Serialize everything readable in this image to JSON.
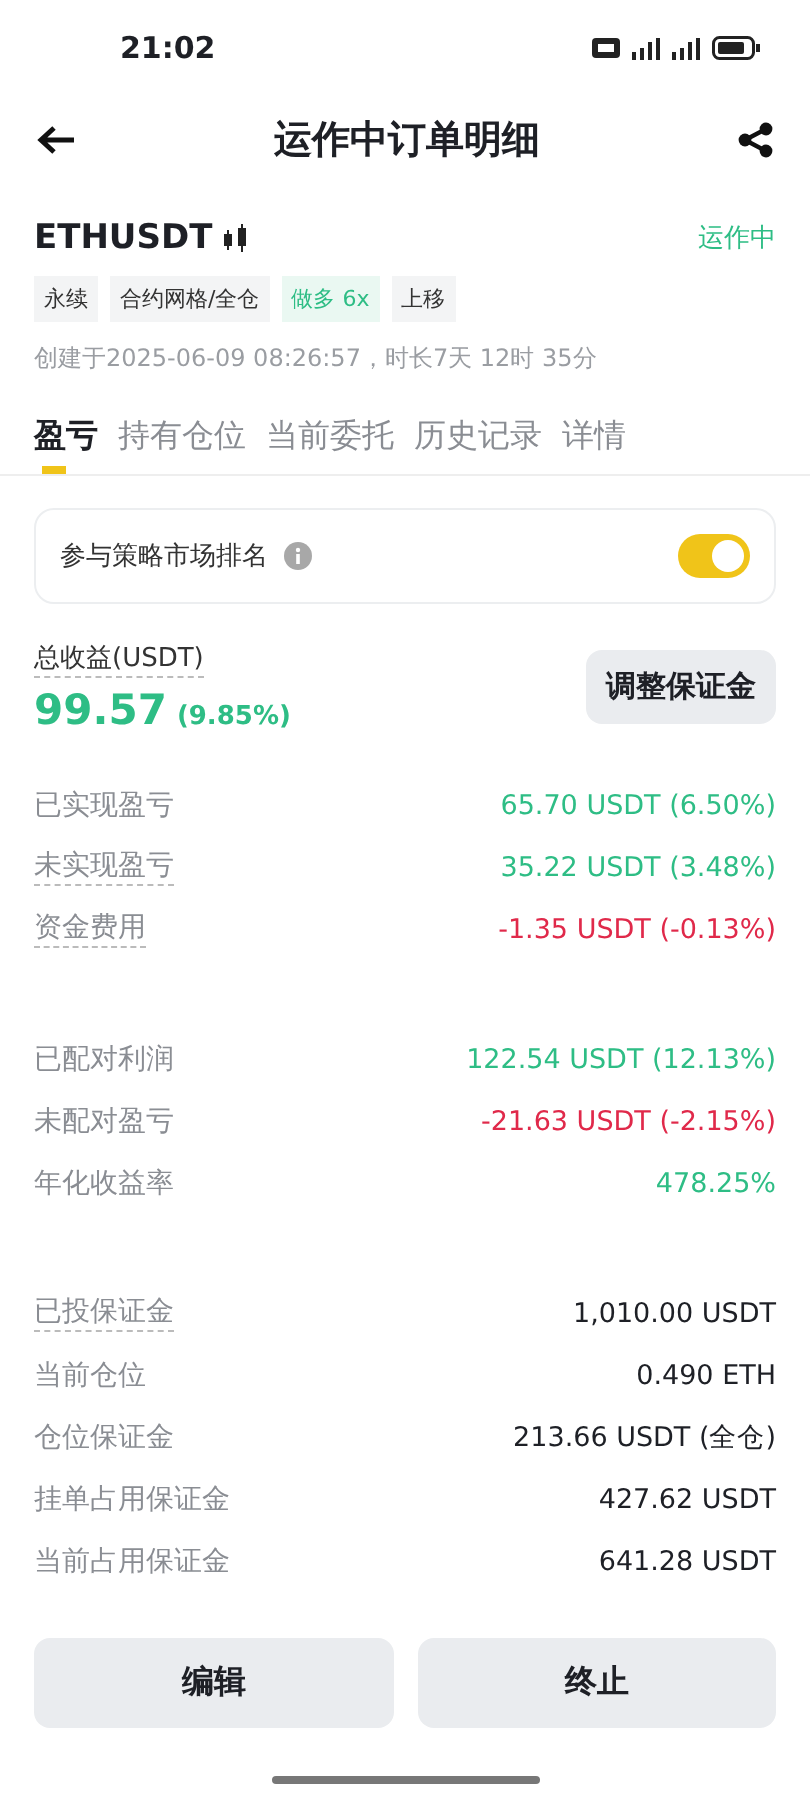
{
  "status_bar": {
    "time": "21:02"
  },
  "header": {
    "title": "运作中订单明细"
  },
  "order": {
    "symbol": "ETHUSDT",
    "status": "运作中",
    "tags": [
      {
        "label": "永续",
        "kind": "plain"
      },
      {
        "label": "合约网格/全仓",
        "kind": "plain"
      },
      {
        "label": "做多 6x",
        "kind": "long"
      },
      {
        "label": "上移",
        "kind": "plain"
      }
    ],
    "created": "创建于2025-06-09 08:26:57，时长7天 12时 35分"
  },
  "tabs": [
    {
      "label": "盈亏",
      "selected": true
    },
    {
      "label": "持有仓位",
      "selected": false
    },
    {
      "label": "当前委托",
      "selected": false
    },
    {
      "label": "历史记录",
      "selected": false
    },
    {
      "label": "详情",
      "selected": false
    }
  ],
  "ranking": {
    "label": "参与策略市场排名",
    "on": true
  },
  "total": {
    "label": "总收益(USDT)",
    "value": "99.57",
    "percent": "(9.85%)",
    "button": "调整保证金"
  },
  "groups": [
    [
      {
        "label": "已实现盈亏",
        "value": "65.70 USDT (6.50%)",
        "color": "#2ebd85",
        "underlined": false
      },
      {
        "label": "未实现盈亏",
        "value": "35.22 USDT (3.48%)",
        "color": "#2ebd85",
        "underlined": true
      },
      {
        "label": "资金费用",
        "value": "-1.35 USDT (-0.13%)",
        "color": "#e0294a",
        "underlined": true
      }
    ],
    [
      {
        "label": "已配对利润",
        "value": "122.54 USDT (12.13%)",
        "color": "#2ebd85",
        "underlined": false
      },
      {
        "label": "未配对盈亏",
        "value": "-21.63 USDT (-2.15%)",
        "color": "#e0294a",
        "underlined": false
      },
      {
        "label": "年化收益率",
        "value": "478.25%",
        "color": "#2ebd85",
        "underlined": false
      }
    ],
    [
      {
        "label": "已投保证金",
        "value": "1,010.00  USDT",
        "color": "#1e2026",
        "underlined": true
      },
      {
        "label": "当前仓位",
        "value": "0.490 ETH",
        "color": "#1e2026",
        "underlined": false
      },
      {
        "label": "仓位保证金",
        "value": "213.66 USDT (全仓)",
        "color": "#1e2026",
        "underlined": false
      },
      {
        "label": "挂单占用保证金",
        "value": "427.62 USDT",
        "color": "#1e2026",
        "underlined": false
      },
      {
        "label": "当前占用保证金",
        "value": "641.28 USDT",
        "color": "#1e2026",
        "underlined": false
      }
    ]
  ],
  "actions": [
    {
      "label": "编辑"
    },
    {
      "label": "终止"
    }
  ]
}
